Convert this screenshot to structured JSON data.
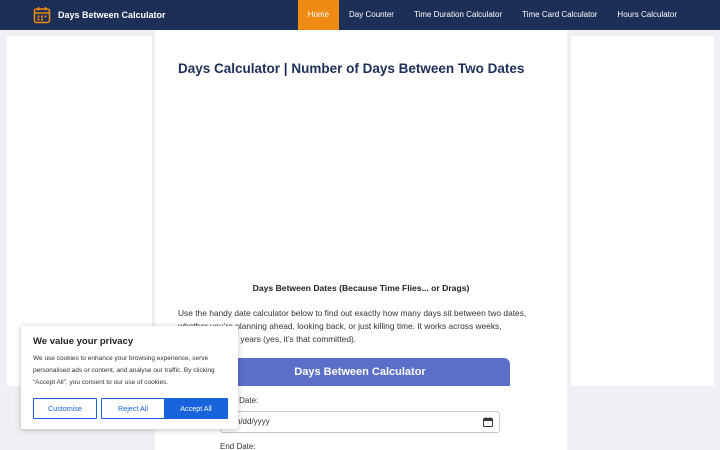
{
  "brand": {
    "name": "Days Between Calculator",
    "icon": "calendar-icon"
  },
  "nav": {
    "items": [
      {
        "label": "Home",
        "active": true
      },
      {
        "label": "Day Counter"
      },
      {
        "label": "Time Duration Calculator"
      },
      {
        "label": "Time Card Calculator"
      },
      {
        "label": "Hours Calculator"
      }
    ]
  },
  "colors": {
    "nav_bg": "#1c2f57",
    "active_tab": "#ef8a12",
    "calc_header": "#5b6fc9",
    "cookie_accent": "#1863dc"
  },
  "main": {
    "title": "Days Calculator | Number of Days Between Two Dates",
    "subheading": "Days Between Dates (Because Time Flies... or Drags)",
    "intro": "Use the handy date calculator below to find out exactly how many days sit between two dates, whether you’re planning ahead, looking back, or just killing time. It works across weeks, months, or even years (yes, it’s that committed)."
  },
  "calculator": {
    "title": "Days Between Calculator",
    "start_label": "Start Date:",
    "start_placeholder": "mm/dd/yyyy",
    "end_label": "End Date:"
  },
  "cookie": {
    "title": "We value your privacy",
    "text": "We use cookies to enhance your browsing experience, serve personalised ads or content, and analyse our traffic. By clicking “Accept All”, you consent to our use of cookies.",
    "customise": "Customise",
    "reject": "Reject All",
    "accept": "Accept All"
  }
}
